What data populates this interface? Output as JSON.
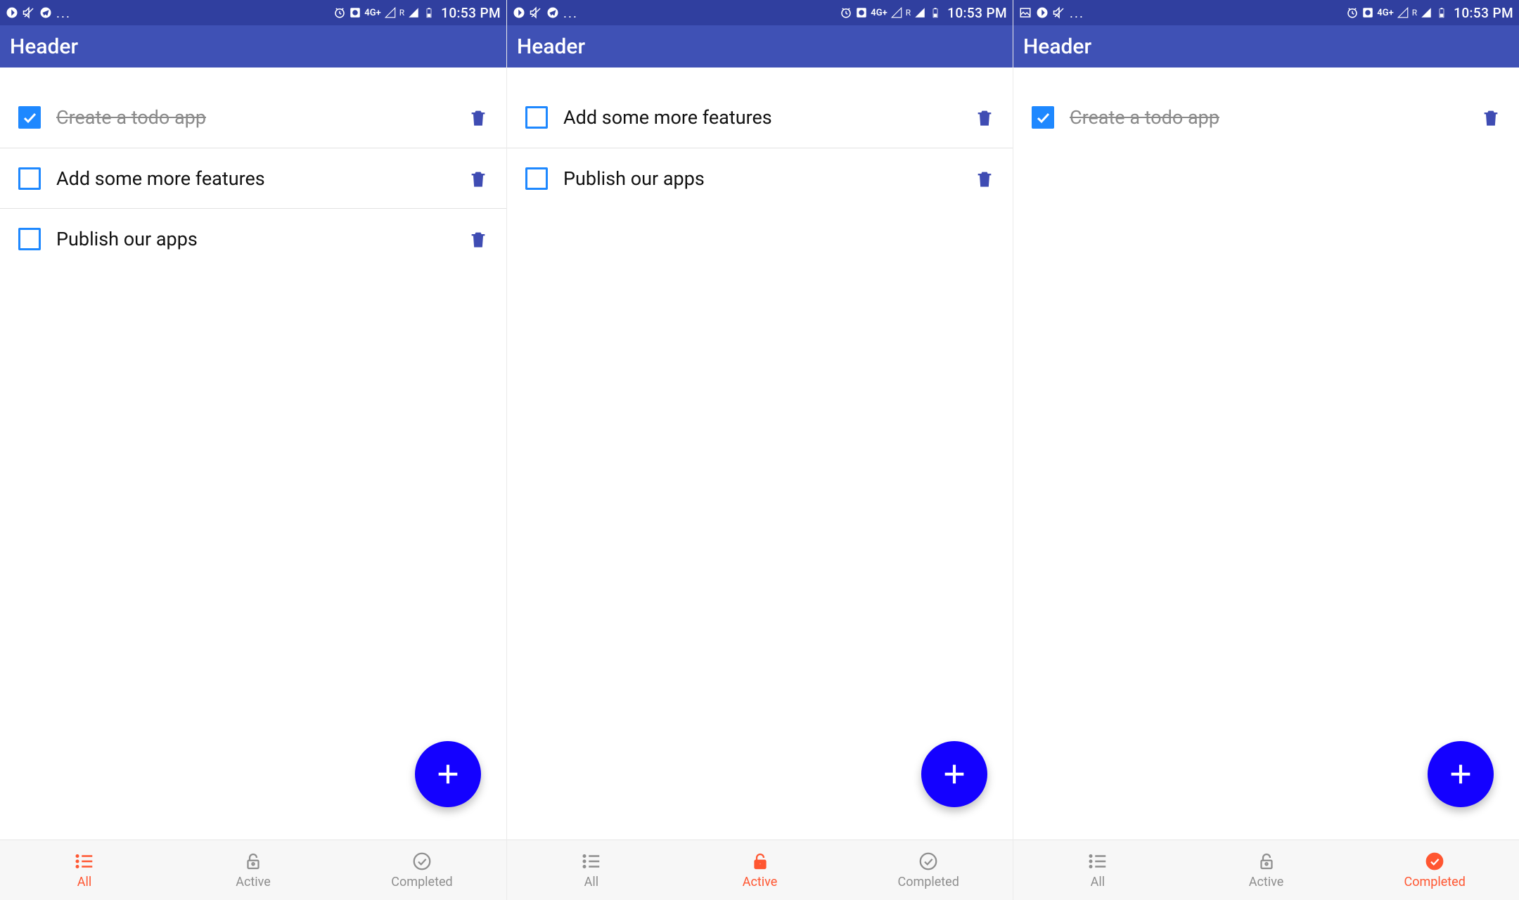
{
  "screens": [
    {
      "status_time": "10:53 PM",
      "header": "Header",
      "todos": [
        {
          "label": "Create a todo app",
          "checked": true
        },
        {
          "label": "Add some more features",
          "checked": false
        },
        {
          "label": "Publish our apps",
          "checked": false
        }
      ],
      "tabs": {
        "all": "All",
        "active": "Active",
        "completed": "Completed",
        "selected": "all"
      }
    },
    {
      "status_time": "10:53 PM",
      "header": "Header",
      "todos": [
        {
          "label": "Add some more features",
          "checked": false
        },
        {
          "label": "Publish our apps",
          "checked": false
        }
      ],
      "tabs": {
        "all": "All",
        "active": "Active",
        "completed": "Completed",
        "selected": "active"
      }
    },
    {
      "status_time": "10:53 PM",
      "header": "Header",
      "todos": [
        {
          "label": "Create a todo app",
          "checked": true
        }
      ],
      "tabs": {
        "all": "All",
        "active": "Active",
        "completed": "Completed",
        "selected": "completed"
      }
    }
  ],
  "status_network": "4G+",
  "status_roaming": "R"
}
